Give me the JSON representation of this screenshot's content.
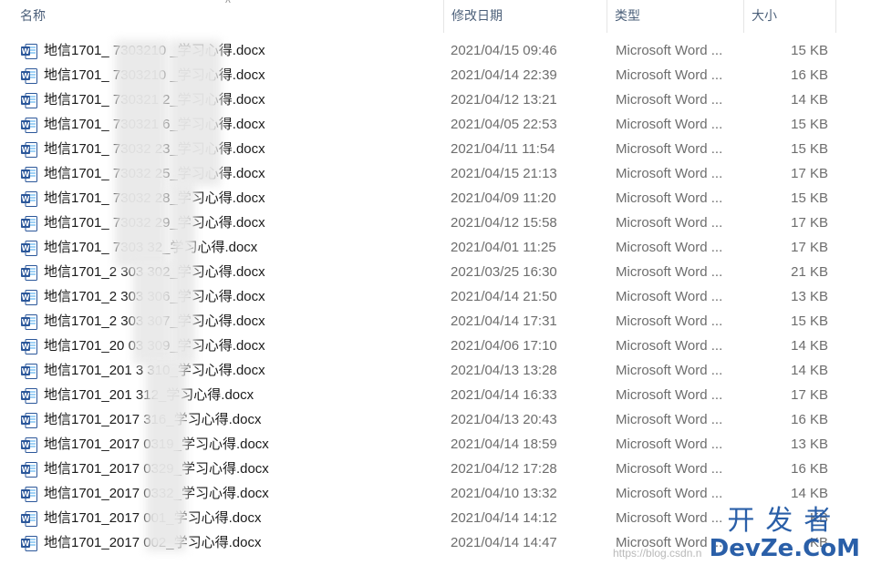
{
  "columns": {
    "name": "名称",
    "date": "修改日期",
    "type": "类型",
    "size": "大小",
    "sort_indicator": "^"
  },
  "files": [
    {
      "name": "地信1701_   7303210    _学习心得.docx",
      "date": "2021/04/15 09:46",
      "type": "Microsoft Word ...",
      "size": "15 KB"
    },
    {
      "name": "地信1701_   7303210    _学习心得.docx",
      "date": "2021/04/14 22:39",
      "type": "Microsoft Word ...",
      "size": "16 KB"
    },
    {
      "name": "地信1701_   730321   2_学习心得.docx",
      "date": "2021/04/12 13:21",
      "type": "Microsoft Word ...",
      "size": "14 KB"
    },
    {
      "name": "地信1701_   730321   6_学习心得.docx",
      "date": "2021/04/05 22:53",
      "type": "Microsoft Word ...",
      "size": "15 KB"
    },
    {
      "name": "地信1701_   73032    23_学习心得.docx",
      "date": "2021/04/11 11:54",
      "type": "Microsoft Word ...",
      "size": "15 KB"
    },
    {
      "name": "地信1701_   73032    25_学习心得.docx",
      "date": "2021/04/15 21:13",
      "type": "Microsoft Word ...",
      "size": "17 KB"
    },
    {
      "name": "地信1701_   73032    28_学习心得.docx",
      "date": "2021/04/09 11:20",
      "type": "Microsoft Word ...",
      "size": "15 KB"
    },
    {
      "name": "地信1701_   73032    29_学习心得.docx",
      "date": "2021/04/12 15:58",
      "type": "Microsoft Word ...",
      "size": "17 KB"
    },
    {
      "name": "地信1701_   7303     32_学习心得.docx",
      "date": "2021/04/01 11:25",
      "type": "Microsoft Word ...",
      "size": "17 KB"
    },
    {
      "name": "地信1701_2   303     302_学习心得.docx",
      "date": "2021/03/25 16:30",
      "type": "Microsoft Word ...",
      "size": "21 KB"
    },
    {
      "name": "地信1701_2   303     306_学习心得.docx",
      "date": "2021/04/14 21:50",
      "type": "Microsoft Word ...",
      "size": "13 KB"
    },
    {
      "name": "地信1701_2   303     307_学习心得.docx",
      "date": "2021/04/14 17:31",
      "type": "Microsoft Word ...",
      "size": "15 KB"
    },
    {
      "name": "地信1701_20   03     309_学习心得.docx",
      "date": "2021/04/06 17:10",
      "type": "Microsoft Word ...",
      "size": "14 KB"
    },
    {
      "name": "地信1701_201   3     310_学习心得.docx",
      "date": "2021/04/13 13:28",
      "type": "Microsoft Word ...",
      "size": "14 KB"
    },
    {
      "name": "地信1701_201        312_学习心得.docx",
      "date": "2021/04/14 16:33",
      "type": "Microsoft Word ...",
      "size": "17 KB"
    },
    {
      "name": "地信1701_2017       316_学习心得.docx",
      "date": "2021/04/13 20:43",
      "type": "Microsoft Word ...",
      "size": "16 KB"
    },
    {
      "name": "地信1701_2017       0319_学习心得.docx",
      "date": "2021/04/14 18:59",
      "type": "Microsoft Word ...",
      "size": "13 KB"
    },
    {
      "name": "地信1701_2017       0329_学习心得.docx",
      "date": "2021/04/12 17:28",
      "type": "Microsoft Word ...",
      "size": "16 KB"
    },
    {
      "name": "地信1701_2017       0332_学习心得.docx",
      "date": "2021/04/10 13:32",
      "type": "Microsoft Word ...",
      "size": "14 KB"
    },
    {
      "name": "地信1701_2017       001_学习心得.docx",
      "date": "2021/04/14 14:12",
      "type": "Microsoft Word ...",
      "size": "KB"
    },
    {
      "name": "地信1701_2017       002_学习心得.docx",
      "date": "2021/04/14 14:47",
      "type": "Microsoft Word ...",
      "size": "KB"
    }
  ],
  "watermark": {
    "top": "开发者",
    "bottom": "DevZe.CoM",
    "faint": "https://blog.csdn.n"
  },
  "colors": {
    "header_text": "#4c607a",
    "row_hover": "#e5f3ff",
    "word_icon_blue": "#2b579a",
    "watermark_blue": "#2a5fa8"
  },
  "icon": "word-document-icon"
}
